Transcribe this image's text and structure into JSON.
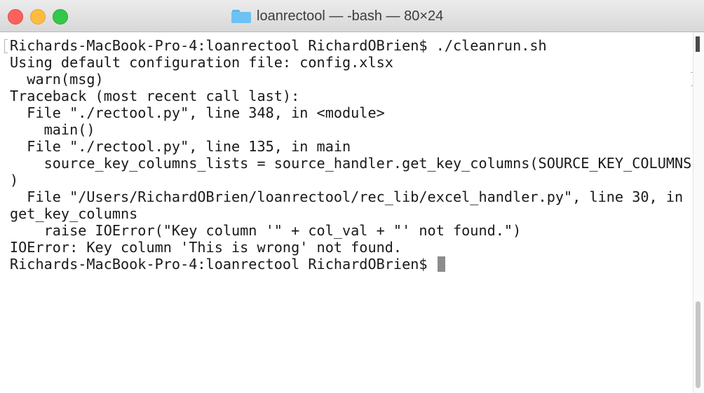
{
  "window": {
    "title": "loanrectool — -bash — 80×24"
  },
  "terminal": {
    "lines": [
      "Richards-MacBook-Pro-4:loanrectool RichardOBrien$ ./cleanrun.sh",
      "Using default configuration file: config.xlsx",
      "  warn(msg)",
      "Traceback (most recent call last):",
      "  File \"./rectool.py\", line 348, in <module>",
      "    main()",
      "  File \"./rectool.py\", line 135, in main",
      "    source_key_columns_lists = source_handler.get_key_columns(SOURCE_KEY_COLUMNS",
      ")",
      "  File \"/Users/RichardOBrien/loanrectool/rec_lib/excel_handler.py\", line 30, in",
      "get_key_columns",
      "    raise IOError(\"Key column '\" + col_val + \"' not found.\")",
      "IOError: Key column 'This is wrong' not found.",
      "Richards-MacBook-Pro-4:loanrectool RichardOBrien$ "
    ]
  },
  "icons": {
    "title_icon": "folder-icon"
  },
  "colors": {
    "close": "#fc605c",
    "minimize": "#fdbc40",
    "zoom": "#34c84a",
    "folder": "#6cc2f3"
  }
}
